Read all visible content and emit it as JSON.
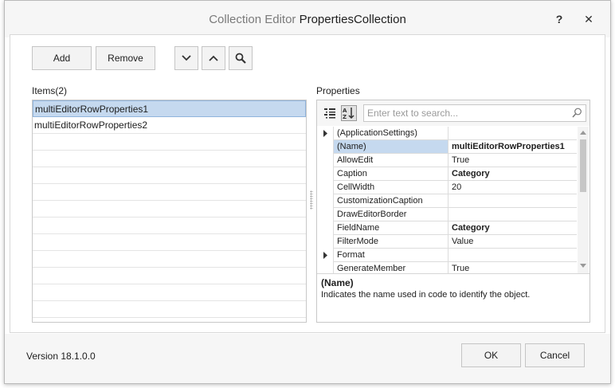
{
  "window": {
    "title_prefix": "Collection Editor",
    "title_main": "PropertiesCollection",
    "help_label": "?",
    "close_label": "✕"
  },
  "toolbar": {
    "add_label": "Add",
    "remove_label": "Remove",
    "move_down_icon": "chevron-down-icon",
    "move_up_icon": "chevron-up-icon",
    "search_icon": "magnifier-icon"
  },
  "items_panel": {
    "label": "Items(2)",
    "items": [
      {
        "label": "multiEditorRowProperties1",
        "selected": true
      },
      {
        "label": "multiEditorRowProperties2",
        "selected": false
      }
    ]
  },
  "properties_panel": {
    "label": "Properties",
    "search_placeholder": "Enter text to search...",
    "rows": [
      {
        "name": "(ApplicationSettings)",
        "value": "",
        "expandable": true,
        "bold": false,
        "selected": false
      },
      {
        "name": "(Name)",
        "value": "multiEditorRowProperties1",
        "expandable": false,
        "bold": true,
        "selected": true
      },
      {
        "name": "AllowEdit",
        "value": "True",
        "expandable": false,
        "bold": false,
        "selected": false
      },
      {
        "name": "Caption",
        "value": "Category",
        "expandable": false,
        "bold": true,
        "selected": false
      },
      {
        "name": "CellWidth",
        "value": "20",
        "expandable": false,
        "bold": false,
        "selected": false
      },
      {
        "name": "CustomizationCaption",
        "value": "",
        "expandable": false,
        "bold": false,
        "selected": false
      },
      {
        "name": "DrawEditorBorder",
        "value": "",
        "expandable": false,
        "bold": false,
        "selected": false
      },
      {
        "name": "FieldName",
        "value": "Category",
        "expandable": false,
        "bold": true,
        "selected": false
      },
      {
        "name": "FilterMode",
        "value": "Value",
        "expandable": false,
        "bold": false,
        "selected": false
      },
      {
        "name": "Format",
        "value": "",
        "expandable": true,
        "bold": false,
        "selected": false
      },
      {
        "name": "GenerateMember",
        "value": "True",
        "expandable": false,
        "bold": false,
        "selected": false
      }
    ],
    "description_title": "(Name)",
    "description_text": "Indicates the name used in code to identify the object."
  },
  "footer": {
    "version": "Version 18.1.0.0",
    "ok_label": "OK",
    "cancel_label": "Cancel"
  },
  "colors": {
    "selection": "#c5d9ef",
    "window_bg": "#f6f6f6",
    "border": "#c8c8c8"
  }
}
